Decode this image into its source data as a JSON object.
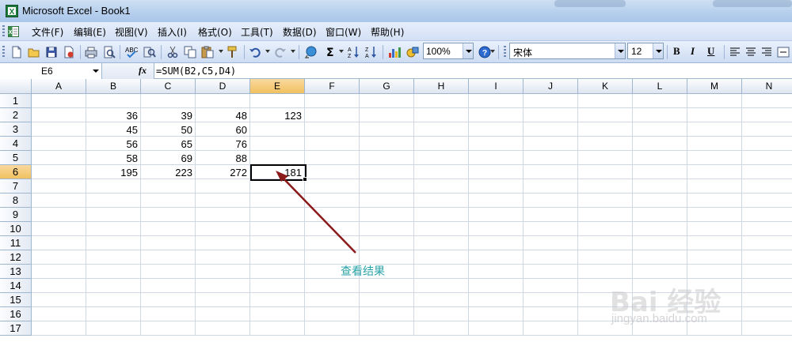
{
  "window": {
    "title": "Microsoft Excel - Book1"
  },
  "menu": {
    "items": [
      "文件(F)",
      "编辑(E)",
      "视图(V)",
      "插入(I)",
      "格式(O)",
      "工具(T)",
      "数据(D)",
      "窗口(W)",
      "帮助(H)"
    ]
  },
  "toolbar": {
    "zoom": "100%",
    "font_name": "宋体",
    "font_size": "12",
    "bold_label": "B",
    "italic_label": "I",
    "underline_label": "U",
    "icons": [
      "new-icon",
      "open-icon",
      "save-icon",
      "permission-icon",
      "print-icon",
      "print-preview-icon",
      "spelling-icon",
      "research-icon",
      "cut-icon",
      "copy-icon",
      "paste-icon",
      "format-painter-icon",
      "undo-icon",
      "redo-icon",
      "hyperlink-icon",
      "autosum-icon",
      "sort-ascending-icon",
      "sort-descending-icon",
      "chart-wizard-icon",
      "drawing-icon",
      "help-icon",
      "align-left-icon",
      "center-icon",
      "align-right-icon",
      "merge-center-icon"
    ]
  },
  "formula_bar": {
    "name_box": "E6",
    "fx": "fx",
    "formula": "=SUM(B2,C5,D4)"
  },
  "sheet": {
    "columns": [
      "A",
      "B",
      "C",
      "D",
      "E",
      "F",
      "G",
      "H",
      "I",
      "J",
      "K",
      "L",
      "M",
      "N"
    ],
    "rows": [
      "1",
      "2",
      "3",
      "4",
      "5",
      "6",
      "7",
      "8",
      "9",
      "10",
      "11",
      "12",
      "13",
      "14",
      "15",
      "16",
      "17"
    ],
    "active_cell": "E6",
    "cells": {
      "B2": "36",
      "C2": "39",
      "D2": "48",
      "E2": "123",
      "B3": "45",
      "C3": "50",
      "D3": "60",
      "B4": "56",
      "C4": "65",
      "D4": "76",
      "B5": "58",
      "C5": "69",
      "D5": "88",
      "B6": "195",
      "C6": "223",
      "D6": "272",
      "E6": "181"
    }
  },
  "annotation": {
    "text": "查看结果",
    "color": "#2aa3a8",
    "arrow_color": "#8b1a1a"
  },
  "watermark": {
    "main": "Bai 经验",
    "sub": "jingyan.baidu.com"
  }
}
